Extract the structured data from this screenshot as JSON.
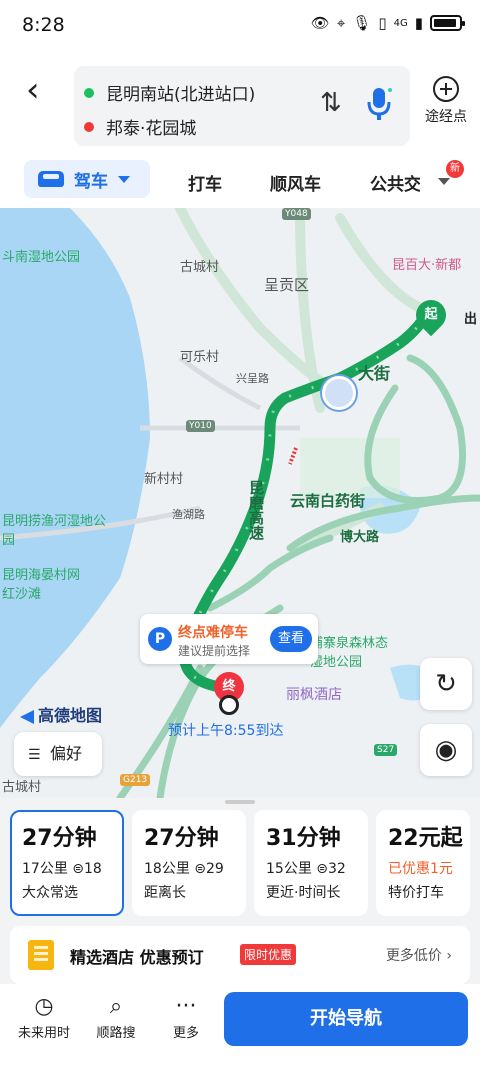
{
  "status_bar": {
    "time": "8:28",
    "network": "4G",
    "icons": [
      "eye-icon",
      "location-icon",
      "mic-icon",
      "vibrate-icon",
      "signal-icon",
      "battery-icon"
    ]
  },
  "header": {
    "origin": "昆明南站(北进站口)",
    "destination": "邦泰·花园城",
    "waypoint_label": "途经点"
  },
  "modes": {
    "active": "驾车",
    "items": [
      "打车",
      "顺风车",
      "公共交"
    ],
    "more_badge": "新"
  },
  "map": {
    "labels": {
      "nan_shidi": "斗南湿地公园",
      "gucheng": "古城村",
      "chenggong": "呈贡区",
      "kunbaida": "昆百大·新都",
      "kele": "可乐村",
      "xingcheng": "兴呈路",
      "xincun": "新村村",
      "yuhu": "渔湖路",
      "kunming_laoyu": "昆明捞渔河湿地公园",
      "kunming_haiyan": "昆明海晏村网红沙滩",
      "yunnan_baiyao": "云南白药街",
      "boda": "博大路",
      "kunmo": "昆磨高速",
      "dajie": "大街",
      "pukan": "浦寨泉森林态湿地公园",
      "lifeng": "丽枫酒店",
      "gucheng2": "古城村",
      "chu": "出"
    },
    "road_shields": [
      "Y048",
      "Y010",
      "G213",
      "S27"
    ],
    "start_marker": "起",
    "end_marker": "终",
    "parking_card": {
      "title": "终点难停车",
      "subtitle": "建议提前选择",
      "button": "查看"
    },
    "eta": "预计上午8:55到达",
    "brand": "高德地图",
    "preference_label": "偏好"
  },
  "routes": [
    {
      "duration": "27分钟",
      "distance": "17公里",
      "lights": "18",
      "tag": "大众常选",
      "selected": true
    },
    {
      "duration": "27分钟",
      "distance": "18公里",
      "lights": "29",
      "tag": "距离长",
      "selected": false
    },
    {
      "duration": "31分钟",
      "distance": "15公里",
      "lights": "32",
      "tag": "更近·时间长",
      "selected": false
    },
    {
      "duration": "22元起",
      "distance": "已优惠1元",
      "tag": "特价打车",
      "selected": false
    }
  ],
  "hotel_banner": {
    "title": "精选酒店 优惠预订",
    "badge": "限时优惠",
    "more": "更多低价"
  },
  "bottom_bar": {
    "future": "未来用时",
    "search_along": "顺路搜",
    "more": "更多",
    "start_nav": "开始导航"
  },
  "colors": {
    "accent": "#1e6fe8",
    "route": "#1aa35b",
    "start": "#1aa35b",
    "end": "#ef3340",
    "highlight": "#f0612b"
  }
}
